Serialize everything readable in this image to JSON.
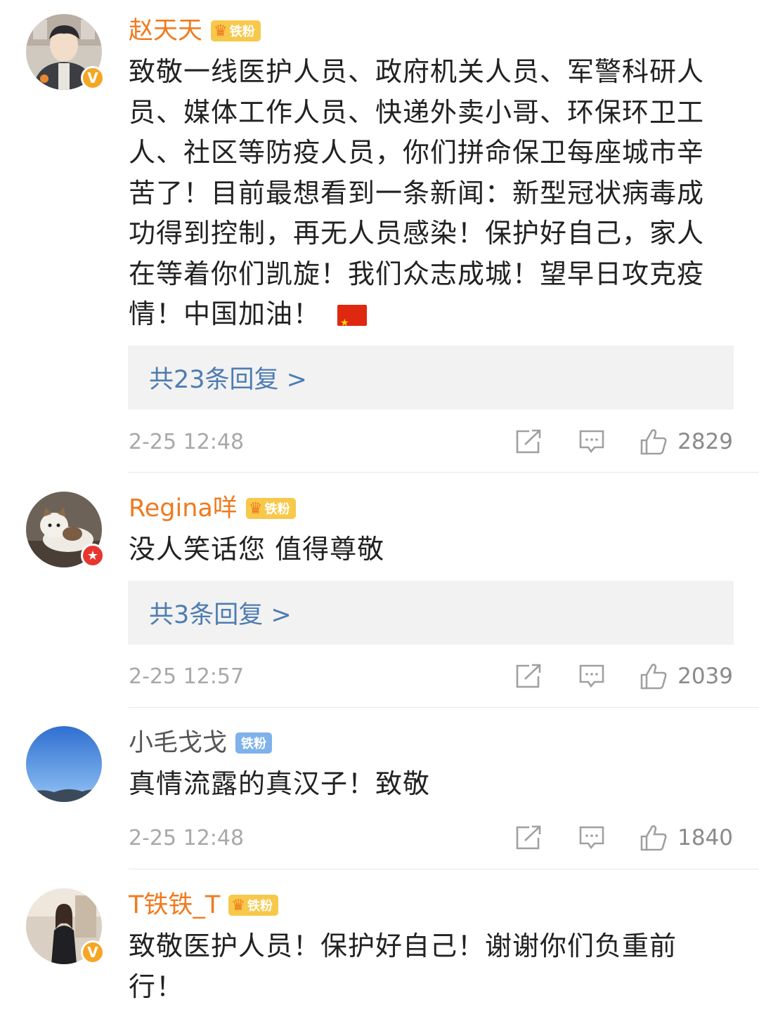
{
  "comments": [
    {
      "username": "赵天天",
      "fan_label": "铁粉",
      "badge": "V",
      "text": "致敬一线医护人员、政府机关人员、军警科研人员、媒体工作人员、快递外卖小哥、环保环卫工人、社区等防疫人员，你们拼命保卫每座城市辛苦了！目前最想看到一条新闻：新型冠状病毒成功得到控制，再无人员感染！保护好自己，家人在等着你们凯旋！我们众志成城！望早日攻克疫情！中国加油！",
      "replies_label": "共23条回复 >",
      "time": "2-25 12:48",
      "likes": "2829"
    },
    {
      "username": "Regina咩",
      "fan_label": "铁粉",
      "badge": "★",
      "text": "没人笑话您 值得尊敬",
      "replies_label": "共3条回复 >",
      "time": "2-25 12:57",
      "likes": "2039"
    },
    {
      "username": "小毛戈戈",
      "fan_label": "铁粉",
      "text": "真情流露的真汉子！致敬",
      "time": "2-25 12:48",
      "likes": "1840"
    },
    {
      "username": "T铁铁_T",
      "fan_label": "铁粉",
      "badge": "V",
      "text": "致敬医护人员！保护好自己！谢谢你们负重前行！"
    }
  ],
  "icons": {
    "share": "share-icon",
    "comment": "comment-icon",
    "like": "thumbs-up-icon",
    "flag": "china-flag-icon",
    "crown": "crown-icon"
  },
  "colors": {
    "username_highlight": "#f07a1e",
    "reply_link": "#4e7cb1",
    "fan_badge": "#f7c84a",
    "fan_badge_blue": "#7fb1ea"
  }
}
